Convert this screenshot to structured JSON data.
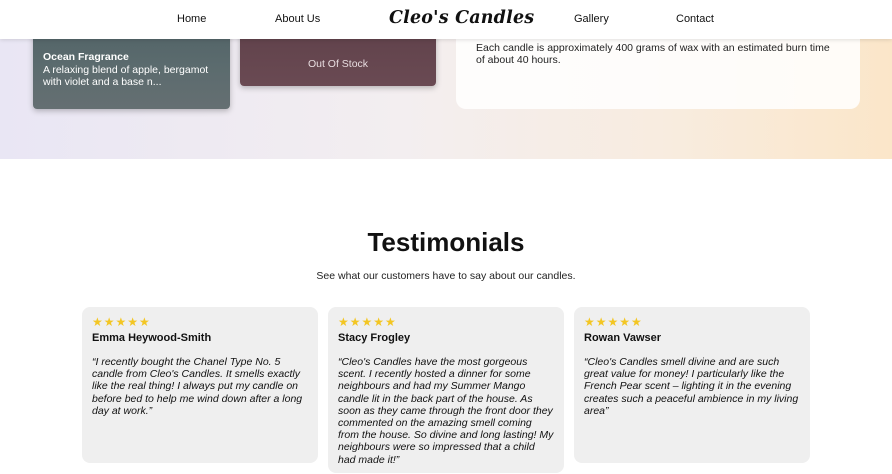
{
  "nav": {
    "home": "Home",
    "about": "About Us",
    "logo": "Cleo's Candles",
    "gallery": "Gallery",
    "contact": "Contact"
  },
  "products": {
    "ocean": {
      "name": "Ocean Fragrance",
      "description": "A relaxing blend of apple, bergamot with violet and a base n..."
    },
    "out_of_stock_label": "Out Of Stock"
  },
  "info": {
    "text": "Each candle is approximately 400 grams of wax with an estimated burn time of about 40 hours."
  },
  "testimonials": {
    "title": "Testimonials",
    "subtitle": "See what our customers have to say about our candles.",
    "items": [
      {
        "stars": "★★★★★",
        "rating": 5,
        "name": "Emma Heywood-Smith",
        "quote": "“I recently bought the Chanel Type No. 5 candle from Cleo's Candles. It smells exactly like the real thing! I always put my candle on before bed to help me wind down after a long day at work.”"
      },
      {
        "stars": "★★★★★",
        "rating": 5,
        "name": "Stacy Frogley",
        "quote": "“Cleo's Candles have the most gorgeous scent. I recently hosted a dinner for some neighbours and had my Summer Mango candle lit in the back part of the house. As soon as they came through the front door they commented on the amazing smell coming from the house. So divine and long lasting! My neighbours were so impressed that a child had made it!”"
      },
      {
        "stars": "★★★★★",
        "rating": 5,
        "name": "Rowan Vawser",
        "quote": "“Cleo's Candles smell divine and are such great value for money! I particularly like the French Pear scent – lighting it in the evening creates such a peaceful ambience in my living area”"
      }
    ]
  },
  "colors": {
    "star": "#f3c623",
    "card_bg": "#efefef",
    "ocean_card": "#5b6b6e",
    "oos_card": "#6a4a53"
  }
}
